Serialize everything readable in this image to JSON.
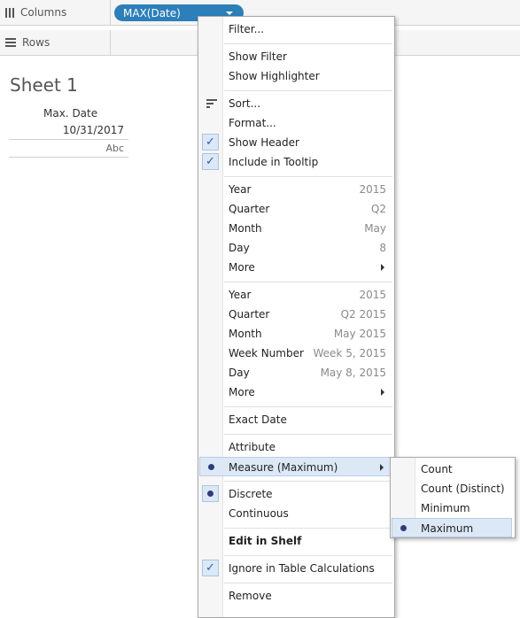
{
  "shelves": {
    "columns_label": "Columns",
    "rows_label": "Rows",
    "pill_label": "MAX(Date)"
  },
  "sheet": {
    "title": "Sheet 1",
    "header": "Max. Date",
    "value": "10/31/2017",
    "abc": "Abc"
  },
  "menu": {
    "filter": "Filter...",
    "show_filter": "Show Filter",
    "show_highlighter": "Show Highlighter",
    "sort": "Sort...",
    "format": "Format...",
    "show_header": "Show Header",
    "include_in_tooltip": "Include in Tooltip",
    "discrete_dates": [
      {
        "label": "Year",
        "example": "2015"
      },
      {
        "label": "Quarter",
        "example": "Q2"
      },
      {
        "label": "Month",
        "example": "May"
      },
      {
        "label": "Day",
        "example": "8"
      },
      {
        "label": "More",
        "example": ""
      }
    ],
    "continuous_dates": [
      {
        "label": "Year",
        "example": "2015"
      },
      {
        "label": "Quarter",
        "example": "Q2 2015"
      },
      {
        "label": "Month",
        "example": "May 2015"
      },
      {
        "label": "Week Number",
        "example": "Week 5, 2015"
      },
      {
        "label": "Day",
        "example": "May 8, 2015"
      },
      {
        "label": "More",
        "example": ""
      }
    ],
    "exact_date": "Exact Date",
    "attribute": "Attribute",
    "measure": "Measure (Maximum)",
    "discrete": "Discrete",
    "continuous": "Continuous",
    "edit_in_shelf": "Edit in Shelf",
    "ignore_table_calcs": "Ignore in Table Calculations",
    "remove": "Remove"
  },
  "submenu": {
    "items": [
      "Count",
      "Count (Distinct)",
      "Minimum",
      "Maximum"
    ],
    "selected": "Maximum"
  },
  "colors": {
    "pill": "#2c7fb8",
    "highlight": "#dce8f6"
  }
}
